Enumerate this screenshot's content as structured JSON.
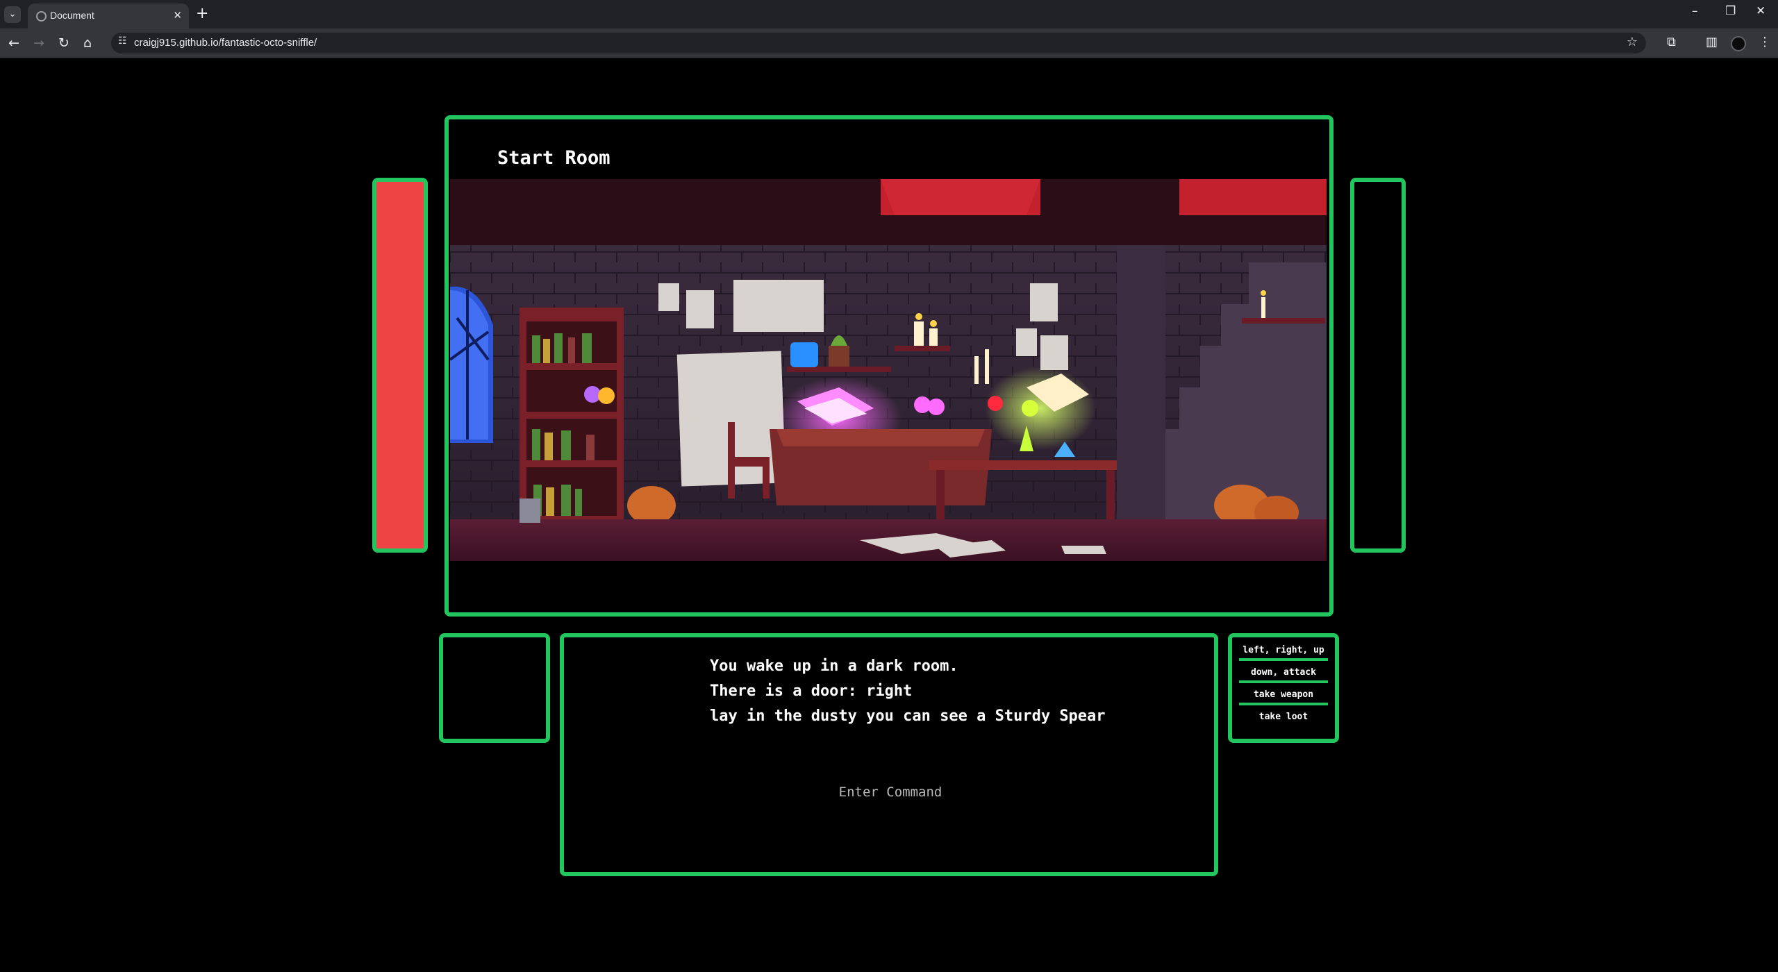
{
  "browser": {
    "tab_title": "Document",
    "url": "craigj915.github.io/fantastic-octo-sniffle/"
  },
  "room": {
    "title": "Start Room"
  },
  "messages": [
    "You wake up in a dark room.",
    "There is a door: right",
    "lay in the dusty you can see a Sturdy Spear"
  ],
  "command": {
    "placeholder": "Enter Command",
    "value": ""
  },
  "help": {
    "items": [
      "left, right, up",
      "down, attack",
      "take weapon",
      "take loot"
    ]
  },
  "colors": {
    "border": "#22c55e",
    "health": "#ef4444",
    "background": "#000000"
  },
  "icons": [
    "back-icon",
    "forward-icon",
    "reload-icon",
    "home-icon",
    "site-info-icon",
    "star-icon",
    "extensions-icon",
    "side-panel-icon",
    "menu-icon"
  ]
}
